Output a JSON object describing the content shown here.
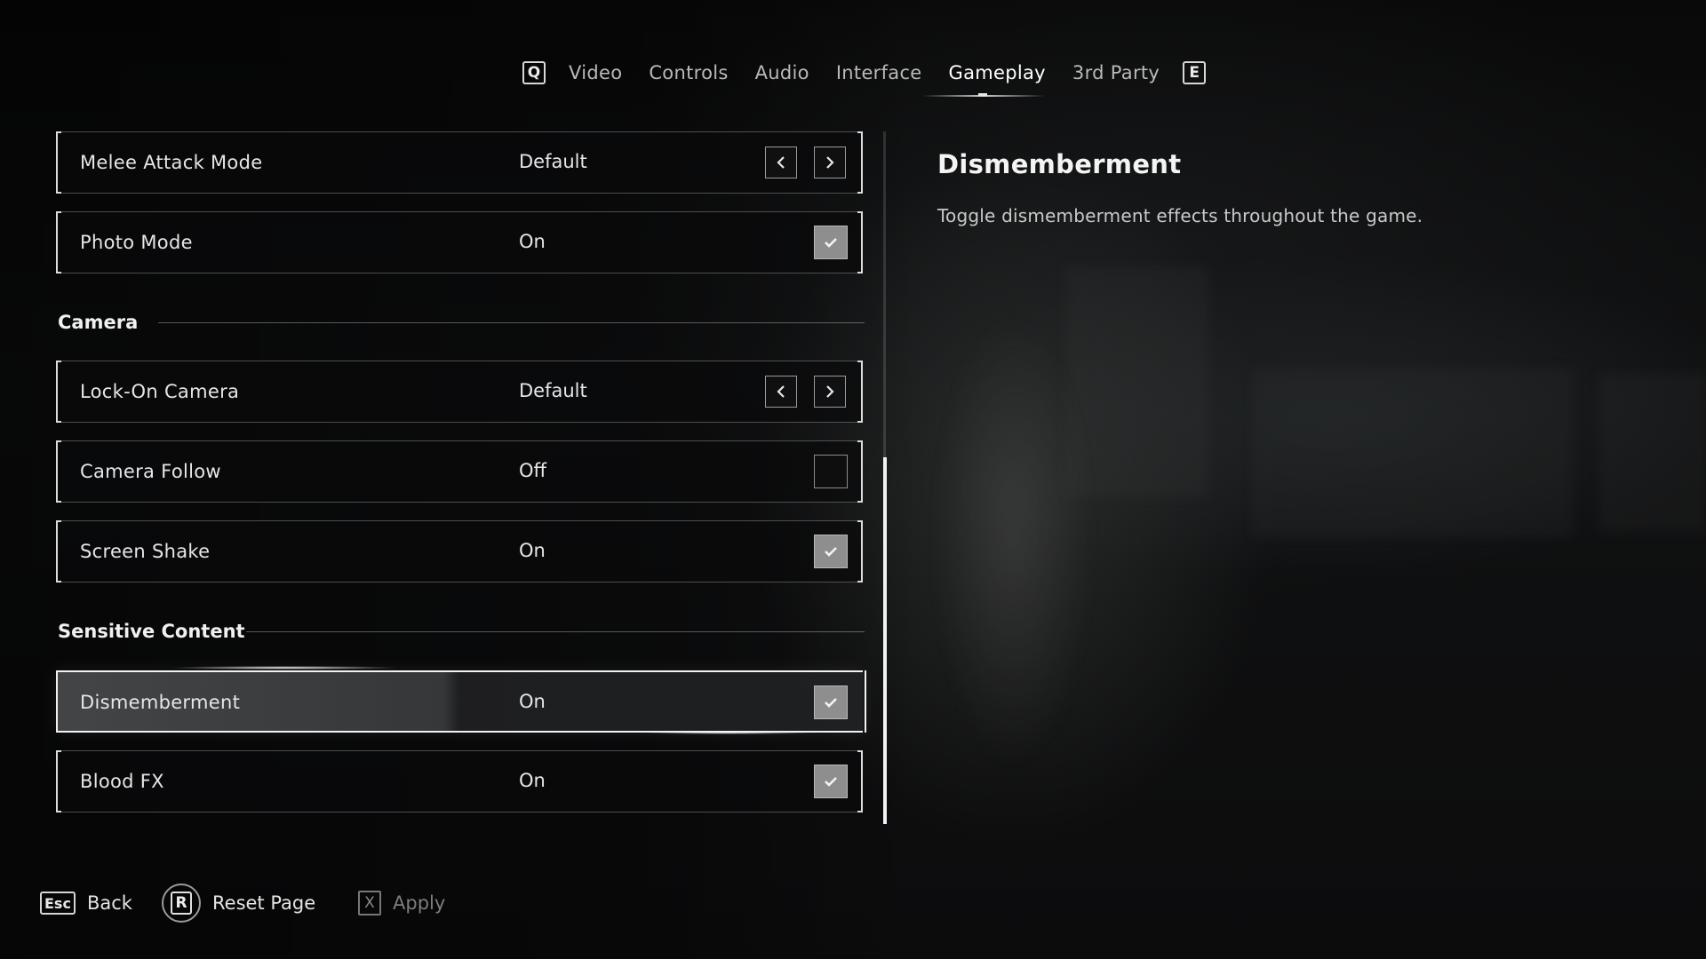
{
  "tabs": {
    "prev_key": "Q",
    "next_key": "E",
    "items": [
      {
        "label": "Video"
      },
      {
        "label": "Controls"
      },
      {
        "label": "Audio"
      },
      {
        "label": "Interface"
      },
      {
        "label": "Gameplay",
        "active": true
      },
      {
        "label": "3rd Party"
      }
    ]
  },
  "settings": {
    "melee_attack_mode": {
      "label": "Melee Attack Mode",
      "value": "Default"
    },
    "photo_mode": {
      "label": "Photo Mode",
      "value": "On",
      "checked": true
    },
    "camera_section": "Camera",
    "lock_on_camera": {
      "label": "Lock-On Camera",
      "value": "Default"
    },
    "camera_follow": {
      "label": "Camera Follow",
      "value": "Off",
      "checked": false
    },
    "screen_shake": {
      "label": "Screen Shake",
      "value": "On",
      "checked": true
    },
    "sensitive_section": "Sensitive Content",
    "dismemberment": {
      "label": "Dismemberment",
      "value": "On",
      "checked": true,
      "selected": true
    },
    "blood_fx": {
      "label": "Blood FX",
      "value": "On",
      "checked": true
    }
  },
  "description": {
    "title": "Dismemberment",
    "text": "Toggle dismemberment effects throughout the game."
  },
  "footer": {
    "back_key": "Esc",
    "back_label": "Back",
    "reset_key": "R",
    "reset_label": "Reset Page",
    "apply_key": "X",
    "apply_label": "Apply"
  },
  "icons": {
    "left_arrow": "chevron-left-icon",
    "right_arrow": "chevron-right-icon",
    "check": "check-icon"
  }
}
